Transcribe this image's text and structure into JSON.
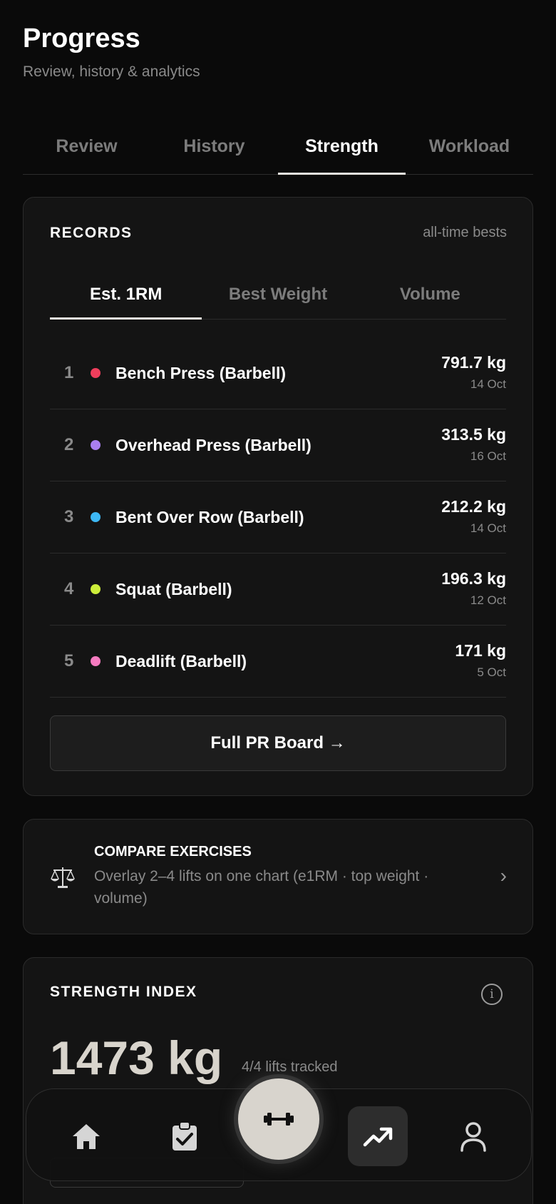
{
  "header": {
    "title": "Progress",
    "subtitle": "Review, history & analytics"
  },
  "main_tabs": [
    {
      "label": "Review",
      "active": false
    },
    {
      "label": "History",
      "active": false
    },
    {
      "label": "Strength",
      "active": true
    },
    {
      "label": "Workload",
      "active": false
    }
  ],
  "records": {
    "label": "RECORDS",
    "note": "all-time bests",
    "tabs": [
      {
        "label": "Est. 1RM",
        "active": true
      },
      {
        "label": "Best Weight",
        "active": false
      },
      {
        "label": "Volume",
        "active": false
      }
    ],
    "items": [
      {
        "rank": "1",
        "name": "Bench Press (Barbell)",
        "value": "791.7 kg",
        "date": "14 Oct",
        "color": "#ef3e5c"
      },
      {
        "rank": "2",
        "name": "Overhead Press (Barbell)",
        "value": "313.5 kg",
        "date": "16 Oct",
        "color": "#a97ff0"
      },
      {
        "rank": "3",
        "name": "Bent Over Row (Barbell)",
        "value": "212.2 kg",
        "date": "14 Oct",
        "color": "#3db8f5"
      },
      {
        "rank": "4",
        "name": "Squat (Barbell)",
        "value": "196.3 kg",
        "date": "12 Oct",
        "color": "#cdee3a"
      },
      {
        "rank": "5",
        "name": "Deadlift (Barbell)",
        "value": "171 kg",
        "date": "5 Oct",
        "color": "#f57bc0"
      }
    ],
    "button_label": "Full PR Board →"
  },
  "compare": {
    "icon": "scale-icon",
    "title": "COMPARE EXERCISES",
    "description": "Overlay 2–4 lifts on one chart (e1RM · top weight · volume)",
    "chevron": "›"
  },
  "strength_index": {
    "label": "STRENGTH INDEX",
    "info_glyph": "i",
    "value": "1473 kg",
    "tracked": "4/4 lifts tracked"
  },
  "bottom_nav": {
    "items": [
      "home-icon",
      "clipboard-check-icon",
      "dumbbell-icon",
      "trending-up-icon",
      "person-icon"
    ],
    "active": "trending-up-icon"
  }
}
